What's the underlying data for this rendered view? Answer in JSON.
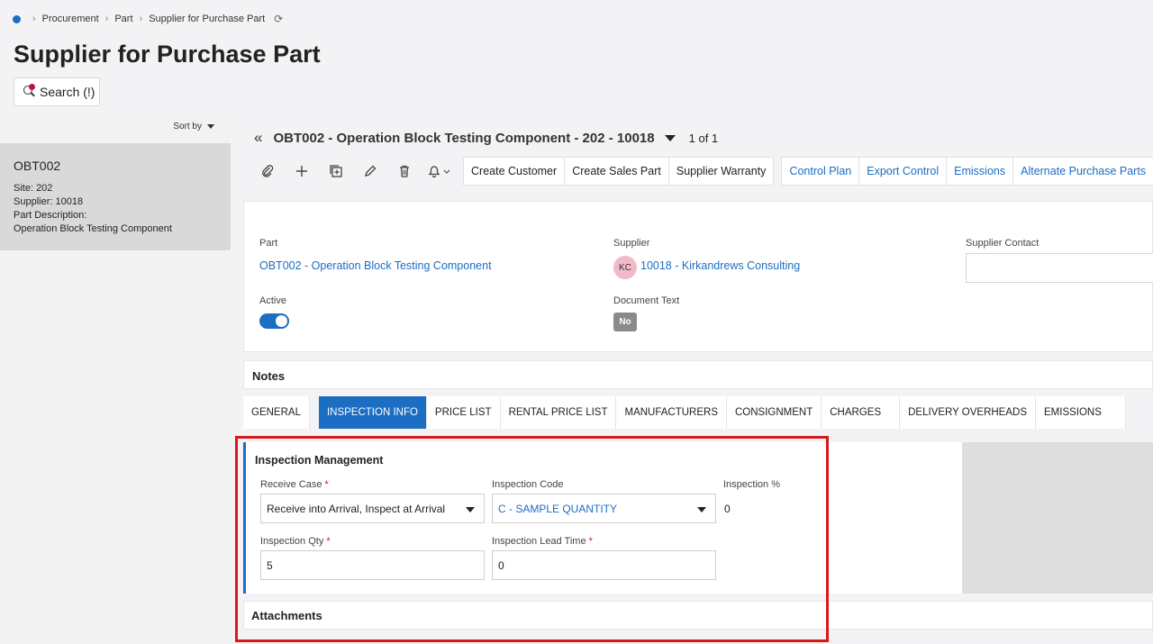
{
  "breadcrumb": {
    "items": [
      "Procurement",
      "Part",
      "Supplier for Purchase Part"
    ]
  },
  "page": {
    "title": "Supplier for Purchase Part"
  },
  "search": {
    "label": "Search (!)"
  },
  "list": {
    "sort_label": "Sort by",
    "card": {
      "id": "OBT002",
      "site": "Site:  202",
      "supplier": "Supplier:  10018",
      "part_desc_label": "Part Description:",
      "part_desc": "Operation Block Testing Component"
    }
  },
  "record": {
    "title": "OBT002 - Operation Block Testing Component - 202 - 10018",
    "count": "1 of 1"
  },
  "toolbar": {
    "buttons": [
      "Create Customer",
      "Create Sales Part",
      "Supplier Warranty"
    ],
    "links": [
      "Control Plan",
      "Export Control",
      "Emissions",
      "Alternate Purchase Parts"
    ]
  },
  "detail": {
    "part_label": "Part",
    "part_value": "OBT002 - Operation Block Testing Component",
    "supplier_label": "Supplier",
    "supplier_initials": "KC",
    "supplier_value": "10018 - Kirkandrews Consulting",
    "contact_label": "Supplier Contact",
    "active_label": "Active",
    "active": true,
    "doctext_label": "Document Text",
    "doctext_value": "No"
  },
  "notes": {
    "label": "Notes"
  },
  "tabs": [
    "GENERAL",
    "INSPECTION INFO",
    "PRICE LIST",
    "RENTAL PRICE LIST",
    "MANUFACTURERS",
    "CONSIGNMENT",
    "CHARGES",
    "DELIVERY OVERHEADS",
    "EMISSIONS"
  ],
  "inspection": {
    "title": "Inspection Management",
    "receive_case_label": "Receive Case",
    "receive_case_value": "Receive into Arrival, Inspect at Arrival",
    "inspection_code_label": "Inspection Code",
    "inspection_code_value": "C - SAMPLE QUANTITY",
    "inspection_pct_label": "Inspection %",
    "inspection_pct_value": "0",
    "inspection_qty_label": "Inspection Qty",
    "inspection_qty_value": "5",
    "lead_time_label": "Inspection Lead Time",
    "lead_time_value": "0",
    "required_mark": "*"
  },
  "attachments": {
    "label": "Attachments"
  },
  "colors": {
    "accent": "#1b6ec2",
    "highlight": "#d7191c",
    "avatar": "#f2b9c8"
  }
}
